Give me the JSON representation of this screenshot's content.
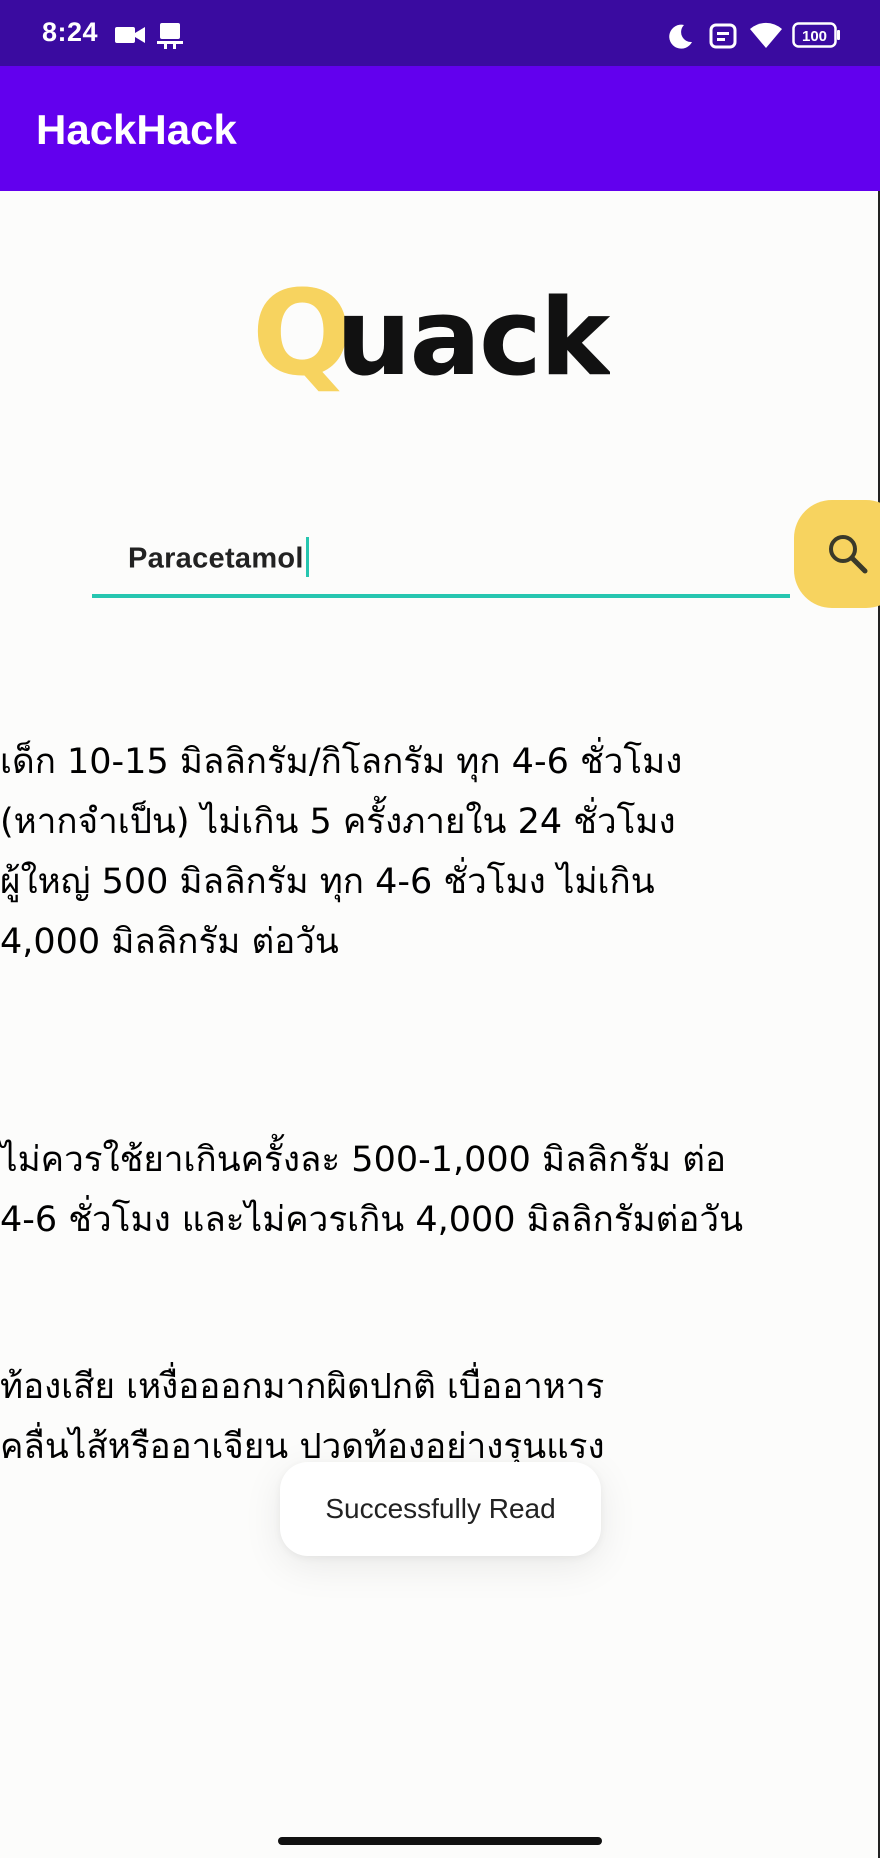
{
  "status_bar": {
    "time": "8:24",
    "battery": "100",
    "icons": [
      "video-camera-icon",
      "cast-icon",
      "moon-icon",
      "nfc-icon",
      "wifi-icon",
      "battery-icon"
    ]
  },
  "app_bar": {
    "title": "HackHack"
  },
  "logo": {
    "first_letter": "Q",
    "rest": "uack",
    "colors": {
      "accent": "#f7d35f",
      "text": "#111111"
    }
  },
  "search": {
    "value": "Paracetamol",
    "icon": "search-icon",
    "underline_color": "#26c6b0",
    "button_color": "#f7d35f"
  },
  "results": {
    "dosage": "เด็ก 10-15 มิลลิกรัม/กิโลกรัม ทุก 4-6 ชั่วโมง\n(หากจำเป็น) ไม่เกิน 5 ครั้งภายใน 24 ชั่วโมง\nผู้ใหญ่ 500 มิลลิกรัม ทุก 4-6 ชั่วโมง ไม่เกิน\n4,000 มิลลิกรัม ต่อวัน",
    "warning": "ไม่ควรใช้ยาเกินครั้งละ 500-1,000 มิลลิกรัม ต่อ\n4-6 ชั่วโมง และไม่ควรเกิน 4,000 มิลลิกรัมต่อวัน",
    "side_effects": "ท้องเสีย เหงื่อออกมากผิดปกติ เบื่ออาหาร\nคลื่นไส้หรืออาเจียน ปวดท้องอย่างรุนแรง"
  },
  "toast": {
    "message": "Successfully Read"
  },
  "colors": {
    "status_bar": "#3a0ba0",
    "app_bar": "#6200ee",
    "background": "#fcfcfb"
  }
}
